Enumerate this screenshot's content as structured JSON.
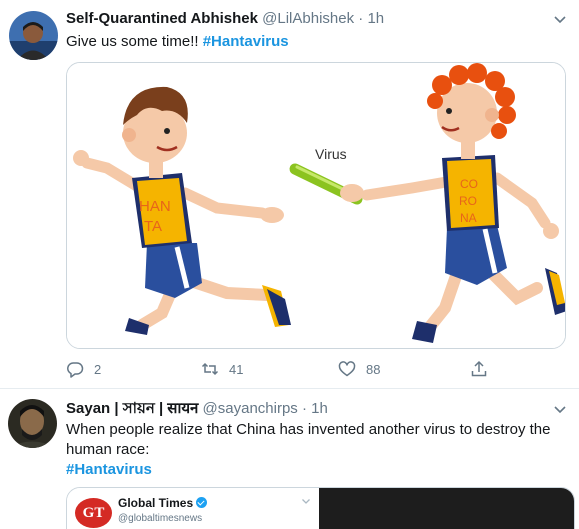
{
  "tweets": [
    {
      "author_name": "Self-Quarantined Abhishek",
      "handle": "@LilAbhishek",
      "separator": "·",
      "time": "1h",
      "text": "Give us some time!! ",
      "hashtag": "#Hantavirus",
      "media": {
        "runner_left_shirt_line1": "HAN",
        "runner_left_shirt_line2": "TA",
        "baton_label": "Virus",
        "runner_right_shirt_line1": "CO",
        "runner_right_shirt_line2": "RO",
        "runner_right_shirt_line3": "NA"
      },
      "actions": {
        "replies": "2",
        "retweets": "41",
        "likes": "88"
      }
    },
    {
      "author_name": "Sayan | সায়ন | सायन",
      "handle": "@sayanchirps",
      "separator": "·",
      "time": "1h",
      "text": "When people realize that China has invented another virus to destroy the human race:",
      "hashtag": "#Hantavirus",
      "quote": {
        "logo_text": "GT",
        "name": "Global Times",
        "handle": "@globaltimesnews"
      }
    }
  ],
  "colors": {
    "link": "#1b95e0",
    "secondary": "#657786",
    "border": "#e6ecf0"
  }
}
